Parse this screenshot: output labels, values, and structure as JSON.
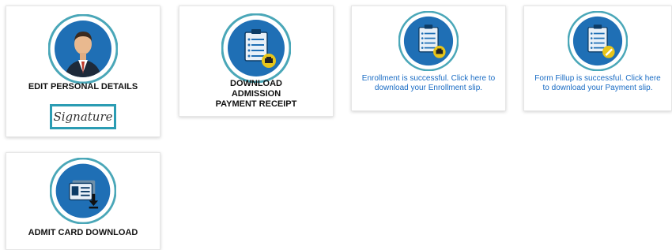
{
  "cards": [
    {
      "title": "EDIT PERSONAL DETAILS",
      "icon": "user-avatar-icon",
      "signature_text": "Signature"
    },
    {
      "title": "DOWNLOAD ADMISSION PAYMENT RECEIPT",
      "icon": "clipboard-receipt-icon"
    },
    {
      "message": "Enrollment is successful. Click here to download your Enrollment slip.",
      "icon": "clipboard-receipt-icon"
    },
    {
      "message": "Form Fillup is successful. Click here to download your Payment slip.",
      "icon": "clipboard-edit-icon"
    },
    {
      "title": "ADMIT CARD DOWNLOAD",
      "icon": "id-card-download-icon"
    }
  ],
  "colors": {
    "circle_blue": "#1f6fb5",
    "ring_teal": "#4aa7b8",
    "link_blue": "#1a6cc4",
    "badge_yellow": "#e8c51a"
  }
}
